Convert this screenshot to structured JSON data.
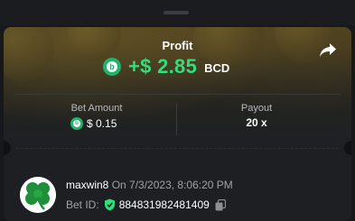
{
  "header": {
    "title": "Profit",
    "share_icon": "share-icon"
  },
  "profit": {
    "amount": "+$ 2.85",
    "currency": "BCD",
    "coin_icon": "bcd-coin-icon",
    "color": "#2fe07a"
  },
  "details": {
    "bet_amount_label": "Bet Amount",
    "bet_amount_value": "$ 0.15",
    "payout_label": "Payout",
    "payout_value": "20 x"
  },
  "user": {
    "name": "maxwin8",
    "date_text": "On 7/3/2023, 8:06:20 PM",
    "avatar_icon": "clover-avatar-icon",
    "bet_id_label": "Bet ID:",
    "bet_id": "884831982481409"
  }
}
